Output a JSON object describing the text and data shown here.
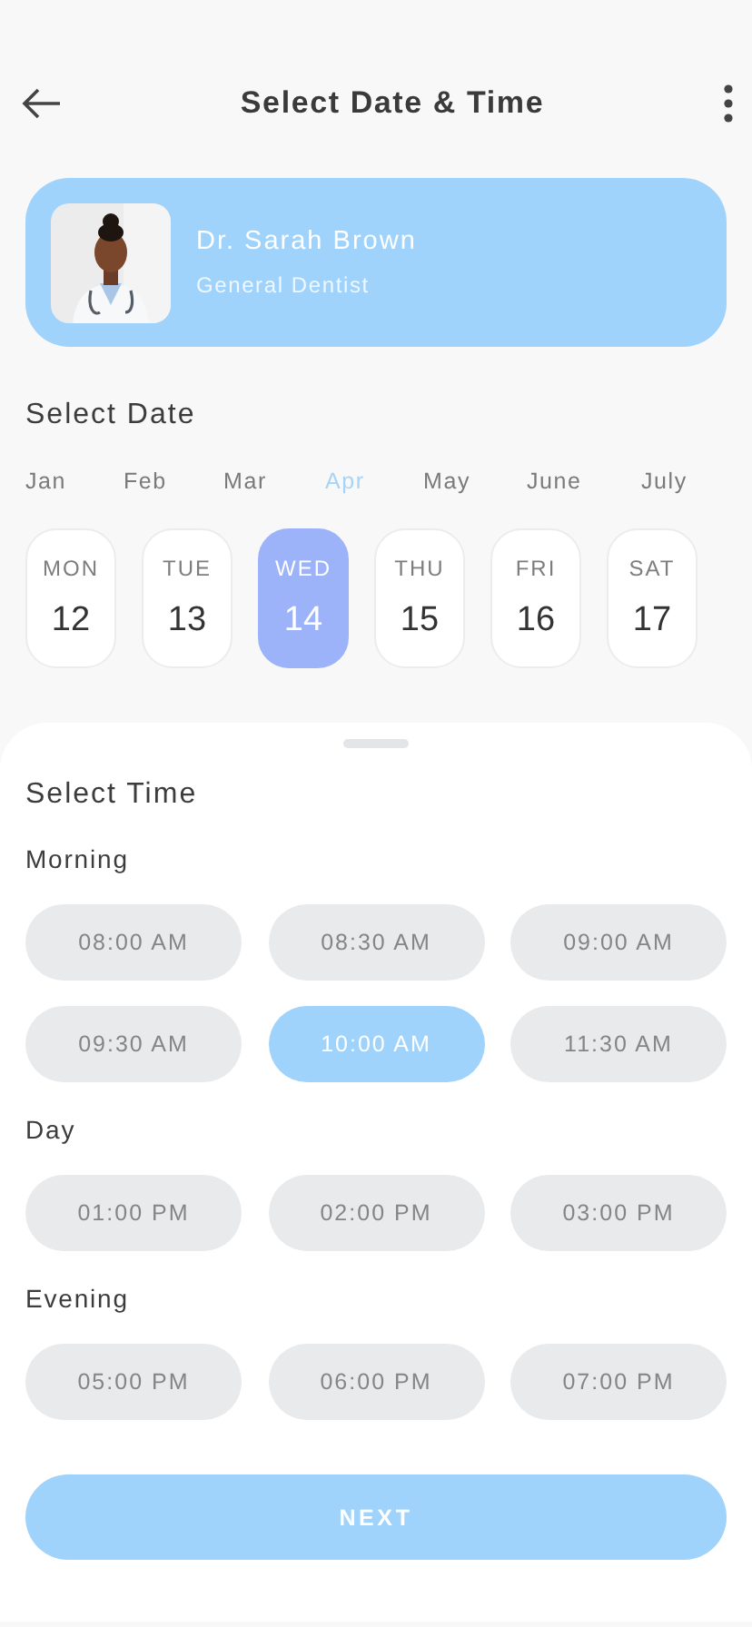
{
  "header": {
    "title": "Select Date & Time"
  },
  "doctor": {
    "name": "Dr. Sarah Brown",
    "specialty": "General Dentist"
  },
  "date_section": {
    "title": "Select Date",
    "months": [
      {
        "label": "Jan",
        "selected": false
      },
      {
        "label": "Feb",
        "selected": false
      },
      {
        "label": "Mar",
        "selected": false
      },
      {
        "label": "Apr",
        "selected": true
      },
      {
        "label": "May",
        "selected": false
      },
      {
        "label": "June",
        "selected": false
      },
      {
        "label": "July",
        "selected": false
      }
    ],
    "days": [
      {
        "weekday": "MON",
        "day": "12",
        "selected": false
      },
      {
        "weekday": "TUE",
        "day": "13",
        "selected": false
      },
      {
        "weekday": "WED",
        "day": "14",
        "selected": true
      },
      {
        "weekday": "THU",
        "day": "15",
        "selected": false
      },
      {
        "weekday": "FRI",
        "day": "16",
        "selected": false
      },
      {
        "weekday": "SAT",
        "day": "17",
        "selected": false
      }
    ]
  },
  "time_section": {
    "title": "Select Time",
    "groups": [
      {
        "label": "Morning",
        "slots": [
          {
            "time": "08:00 AM",
            "selected": false
          },
          {
            "time": "08:30 AM",
            "selected": false
          },
          {
            "time": "09:00 AM",
            "selected": false
          },
          {
            "time": "09:30 AM",
            "selected": false
          },
          {
            "time": "10:00 AM",
            "selected": true
          },
          {
            "time": "11:30 AM",
            "selected": false
          }
        ]
      },
      {
        "label": "Day",
        "slots": [
          {
            "time": "01:00 PM",
            "selected": false
          },
          {
            "time": "02:00 PM",
            "selected": false
          },
          {
            "time": "03:00 PM",
            "selected": false
          }
        ]
      },
      {
        "label": "Evening",
        "slots": [
          {
            "time": "05:00 PM",
            "selected": false
          },
          {
            "time": "06:00 PM",
            "selected": false
          },
          {
            "time": "07:00 PM",
            "selected": false
          }
        ]
      }
    ]
  },
  "next_button": {
    "label": "NEXT"
  }
}
